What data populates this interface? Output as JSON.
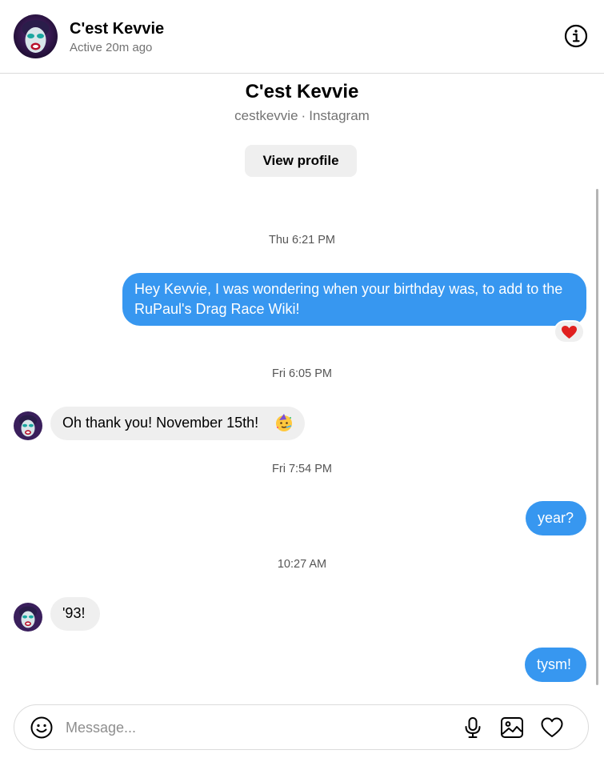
{
  "header": {
    "name": "C'est Kevvie",
    "status": "Active 20m ago",
    "avatar_icon": "profile-avatar",
    "info_icon": "info-icon"
  },
  "profile": {
    "name": "C'est Kevvie",
    "username": "cestkevvie",
    "separator": "·",
    "platform": "Instagram",
    "view_profile_label": "View profile"
  },
  "timestamps": [
    "Thu 6:21 PM",
    "Fri 6:05 PM",
    "Fri 7:54 PM",
    "10:27 AM"
  ],
  "messages": [
    {
      "direction": "outgoing",
      "text": "Hey Kevvie, I was wondering when your birthday was, to add to the RuPaul's Drag Race Wiki!",
      "reaction": "heart"
    },
    {
      "direction": "incoming",
      "text": "Oh thank you! November 15th!",
      "emoji": "partying-face"
    },
    {
      "direction": "outgoing",
      "text": "year?"
    },
    {
      "direction": "incoming",
      "text": "'93!"
    },
    {
      "direction": "outgoing",
      "text": "tysm!"
    }
  ],
  "composer": {
    "placeholder": "Message...",
    "icons": [
      "emoji-icon",
      "microphone-icon",
      "image-icon",
      "heart-icon"
    ]
  },
  "colors": {
    "outgoing_bubble": "#3797f0",
    "incoming_bubble": "#efefef",
    "reaction_heart": "#e0201f",
    "secondary_text": "#737373"
  }
}
